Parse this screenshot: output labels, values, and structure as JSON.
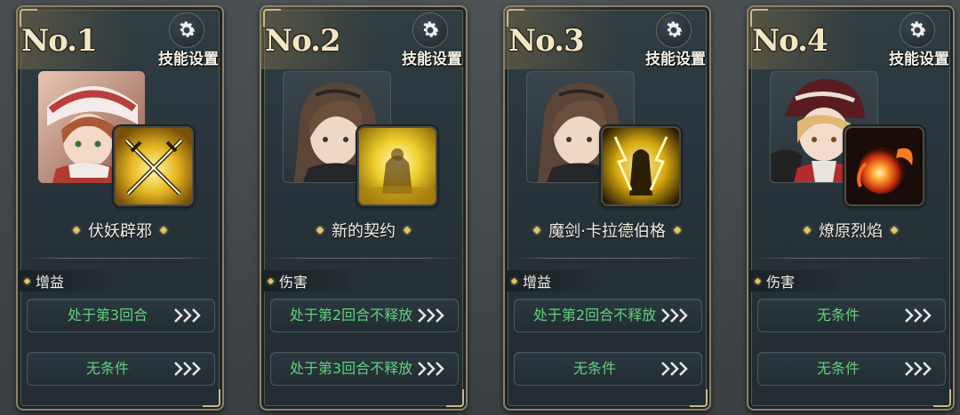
{
  "gear_label": "技能设置",
  "cards": [
    {
      "rank": "No.1",
      "skill_name": "伏妖辟邪",
      "type": "增益",
      "conditions": [
        "处于第3回合",
        "无条件"
      ],
      "portrait": "portrait-girl-red-hood",
      "skill_icon": "crossed-swords-icon"
    },
    {
      "rank": "No.2",
      "skill_name": "新的契约",
      "type": "伤害",
      "conditions": [
        "处于第2回合不释放",
        "处于第3回合不释放"
      ],
      "portrait": "portrait-brown-hair",
      "skill_icon": "golden-figure-icon"
    },
    {
      "rank": "No.3",
      "skill_name": "魔剑·卡拉德伯格",
      "type": "增益",
      "conditions": [
        "处于第2回合不释放",
        "无条件"
      ],
      "portrait": "portrait-brown-hair",
      "skill_icon": "lightning-knight-icon"
    },
    {
      "rank": "No.4",
      "skill_name": "燎原烈焰",
      "type": "伤害",
      "conditions": [
        "无条件",
        "无条件"
      ],
      "portrait": "portrait-blonde-beanie",
      "skill_icon": "fireball-icon"
    }
  ],
  "colors": {
    "condition_text": "#62d07f",
    "accent_gold": "#e9c766",
    "frame_border": "#8c826a"
  }
}
